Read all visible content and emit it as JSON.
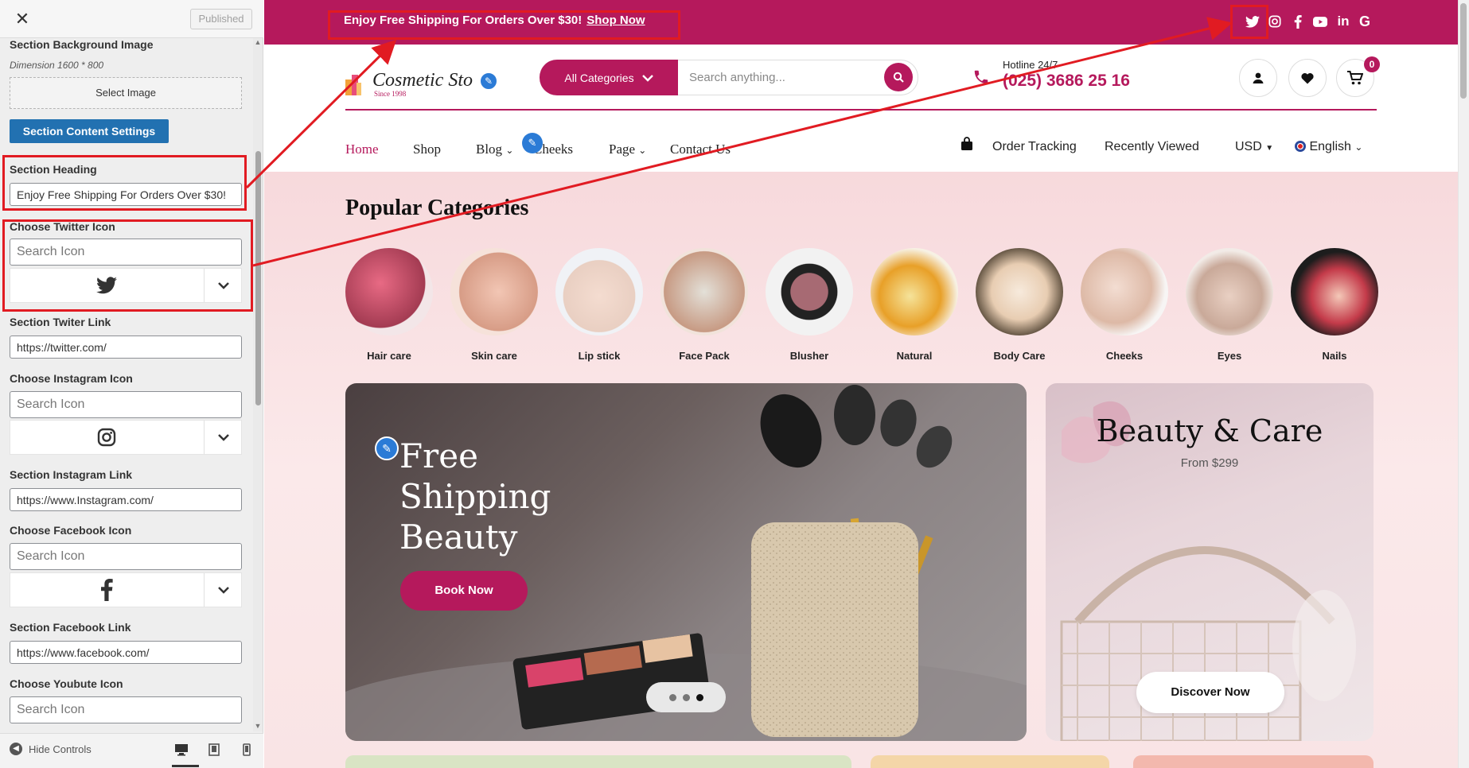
{
  "customizer": {
    "published_label": "Published",
    "bg_image_label": "Section Background Image",
    "dimension_note": "Dimension 1600 * 800",
    "select_image_label": "Select Image",
    "content_settings_label": "Section Content Settings",
    "heading_label": "Section Heading",
    "heading_value": "Enjoy Free Shipping For Orders Over $30!",
    "twitter_icon_label": "Choose Twitter Icon",
    "twitter_link_label": "Section Twiter Link",
    "twitter_link_value": "https://twitter.com/",
    "instagram_icon_label": "Choose Instagram Icon",
    "instagram_link_label": "Section Instagram Link",
    "instagram_link_value": "https://www.Instagram.com/",
    "facebook_icon_label": "Choose Facebook Icon",
    "facebook_link_label": "Section Facebook Link",
    "facebook_link_value": "https://www.facebook.com/",
    "youtube_icon_label": "Choose Youbute Icon",
    "search_icon_placeholder": "Search Icon",
    "hide_controls_label": "Hide Controls",
    "devices": [
      "desktop",
      "tablet",
      "mobile"
    ]
  },
  "topbar": {
    "shipping_text": "Enjoy Free Shipping For Orders Over $30!",
    "shop_now": "Shop Now",
    "socials": [
      "twitter-icon",
      "instagram-icon",
      "facebook-icon",
      "youtube-icon",
      "linkedin-icon",
      "google-icon"
    ]
  },
  "header": {
    "logo_text": "Cosmetic Sto",
    "logo_sub": "Since 1998",
    "categories_label": "All Categories",
    "search_placeholder": "Search anything...",
    "hotline_label": "Hotline 24/7",
    "hotline_number": "(025) 3686 25 16",
    "cart_count": "0"
  },
  "nav": {
    "items": [
      "Home",
      "Shop",
      "Blog",
      "Cheeks",
      "Page",
      "Contact Us"
    ],
    "order_tracking": "Order Tracking",
    "recently_viewed": "Recently Viewed",
    "currency": "USD",
    "language": "English"
  },
  "popular": {
    "title": "Popular Categories",
    "categories": [
      "Hair care",
      "Skin care",
      "Lip stick",
      "Face Pack",
      "Blusher",
      "Natural",
      "Body Care",
      "Cheeks",
      "Eyes",
      "Nails"
    ]
  },
  "banner_main": {
    "title_line1": "Free",
    "title_line2": "Shipping",
    "title_line3": "Beauty",
    "button": "Book Now"
  },
  "banner_side": {
    "title": "Beauty & Care",
    "subtitle": "From $299",
    "button": "Discover Now"
  },
  "colors": {
    "brand": "#b5195c",
    "annotation": "#e11b22",
    "primary_button": "#2271b1",
    "edit_pencil": "#2b7bd6"
  }
}
